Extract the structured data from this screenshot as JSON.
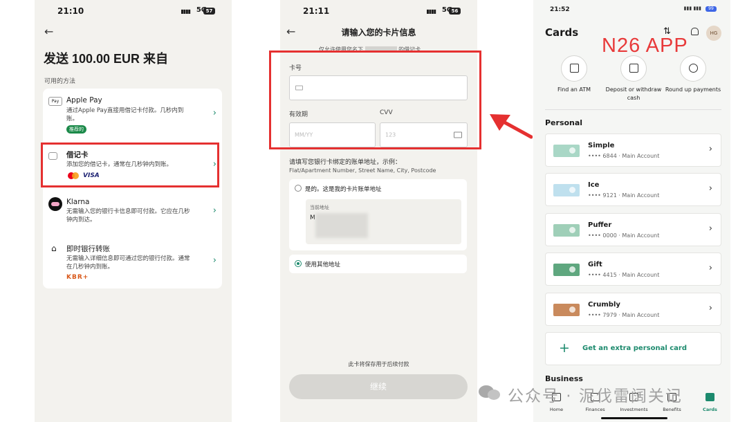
{
  "panel1": {
    "status": {
      "time": "21:10",
      "network": "5G",
      "battery": "57"
    },
    "title": "发送 100.00 EUR 来自",
    "section_label": "可用的方法",
    "methods": [
      {
        "name": "Apple Pay",
        "icon_text": "Pay",
        "icon": "apple-pay-icon",
        "desc": "通过Apple Pay直接用借记卡付款。几秒内到账。",
        "badge": "推荐的"
      },
      {
        "name": "借记卡",
        "icon": "card-icon",
        "desc": "添加您的借记卡，通常在几秒钟内到账。",
        "brands": [
          "mastercard",
          "VISA"
        ]
      },
      {
        "name": "Klarna",
        "icon": "klarna-icon",
        "desc": "无需输入您的银行卡信息即可付款。它应在几秒钟内到达。"
      },
      {
        "name": "即时银行转账",
        "icon": "bank-icon",
        "desc": "无需输入详细信息即可通过您的银行付款。通常在几秒钟内到账。",
        "logos": "KBR+"
      }
    ]
  },
  "panel2": {
    "status": {
      "time": "21:11",
      "network": "5G",
      "battery": "56"
    },
    "title": "请输入您的卡片信息",
    "subtitle_left": "仅允许使用您名下",
    "subtitle_right": "的借记卡",
    "card_number_label": "卡号",
    "expiry_label": "有效期",
    "expiry_placeholder": "MM/YY",
    "cvv_label": "CVV",
    "cvv_placeholder": "123",
    "address_help": "请填写您银行卡绑定的账单地址，示例：",
    "address_example": "Flat/Apartment Number, Street Name, City, Postcode",
    "option_my_address": "是的。这是我的卡片账单地址",
    "current_address_label": "当前地址",
    "current_address_value": "M",
    "option_other_address": "使用其他地址",
    "save_note": "此卡将保存用于后续付款",
    "continue_button": "继续"
  },
  "panel3": {
    "status": {
      "time": "21:52",
      "battery": "99"
    },
    "header": "Cards",
    "overlay_label": "N26 APP",
    "avatar_initials": "HG",
    "quick_actions": [
      {
        "label": "Find an ATM",
        "icon": "map-icon"
      },
      {
        "label": "Deposit or withdraw cash",
        "icon": "store-icon"
      },
      {
        "label": "Round up payments",
        "icon": "coin-icon"
      }
    ],
    "personal_label": "Personal",
    "cards": [
      {
        "name": "Simple",
        "sub": "•••• 6844 · Main Account",
        "color": "#a9d7c6"
      },
      {
        "name": "Ice",
        "sub": "•••• 9121 · Main Account",
        "color": "#bfe0ee"
      },
      {
        "name": "Puffer",
        "sub": "•••• 0000 · Main Account",
        "color": "#9fcfb8"
      },
      {
        "name": "Gift",
        "sub": "•••• 4415 · Main Account",
        "color": "#5fa77f"
      },
      {
        "name": "Crumbly",
        "sub": "•••• 7979 · Main Account",
        "color": "#c98a5d"
      }
    ],
    "extra_card": "Get an extra personal card",
    "business_label": "Business",
    "tabs": [
      {
        "label": "Home",
        "icon": "home-icon"
      },
      {
        "label": "Finances",
        "icon": "finances-icon"
      },
      {
        "label": "Investments",
        "icon": "investments-icon"
      },
      {
        "label": "Benefits",
        "icon": "benefits-icon"
      },
      {
        "label": "Cards",
        "icon": "cards-icon",
        "active": true
      }
    ]
  },
  "watermark": "公众号 · 泥伐雷阔关记",
  "colors": {
    "highlight": "#e53030",
    "accent": "#1c8a6d",
    "annotation": "#e83a3a"
  }
}
